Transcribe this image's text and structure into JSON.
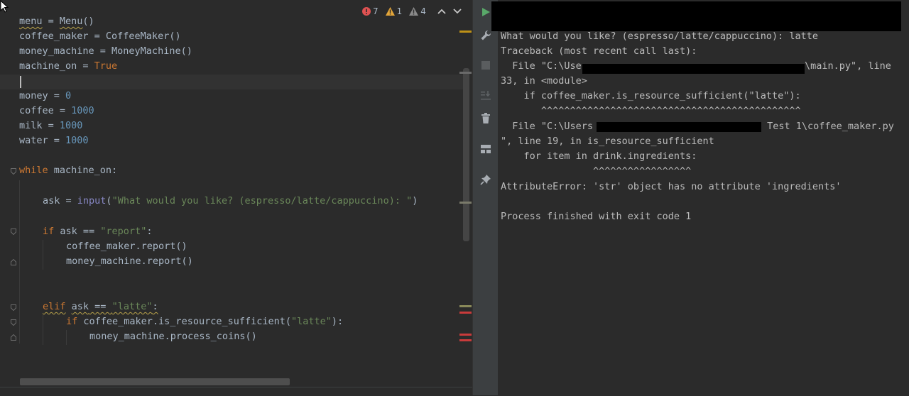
{
  "inspections": {
    "errors": "7",
    "warnings": "1",
    "weak_warnings": "4"
  },
  "code": {
    "l1": {
      "a": "menu",
      "b": " = ",
      "c": "Menu",
      "d": "()"
    },
    "l2": "coffee_maker = CoffeeMaker()",
    "l3": "money_machine = MoneyMachine()",
    "l4": {
      "a": "machine_on = ",
      "b": "True"
    },
    "l6": {
      "a": "money = ",
      "b": "0"
    },
    "l7": {
      "a": "coffee = ",
      "b": "1000"
    },
    "l8": {
      "a": "milk = ",
      "b": "1000"
    },
    "l9": {
      "a": "water = ",
      "b": "1000"
    },
    "l11": {
      "a": "while",
      "b": " machine_on:"
    },
    "l13": {
      "a": "ask = ",
      "b": "input",
      "c": "(",
      "d": "\"What would you like? (espresso/latte/cappuccino): \"",
      "e": ")"
    },
    "l15": {
      "a": "if",
      "b": " ask == ",
      "c": "\"report\"",
      "d": ":"
    },
    "l16": "coffee_maker.report()",
    "l17": "money_machine.report()",
    "l20": {
      "a": "elif",
      "b": " ",
      "c": "ask",
      "d": " == ",
      "e": "\"latte\"",
      "f": ":"
    },
    "l21": {
      "a": "if",
      "b": " coffee_maker.is_resource_sufficient(",
      "c": "\"latte\"",
      "d": "):"
    },
    "l22": "money_machine.process_coins()"
  },
  "console": {
    "prompt": "What would you like? (espresso/latte/cappuccino): latte",
    "traceback": "Traceback (most recent call last):",
    "file1_start": "  File \"C:\\Use",
    "file1_end": "\\main.py\", line",
    "file1_cont": "33, in <module>",
    "code1": "    if coffee_maker.is_resource_sufficient(\"latte\"):",
    "carets1": "       ^^^^^^^^^^^^^^^^^^^^^^^^^^^^^^^^^^^^^^^^^^^^^",
    "file2_start": "  File \"C:\\Users",
    "file2_end": " Test 1\\coffee_maker.py",
    "file2_cont": "\", line 19, in is_resource_sufficient",
    "code2": "    for item in drink.ingredients:",
    "carets2": "                ^^^^^^^^^^^^^^^^^",
    "error": "AttributeError: 'str' object has no attribute 'ingredients'",
    "exit": "Process finished with exit code 1"
  },
  "colors": {
    "background": "#2b2b2b",
    "keyword": "#cc7832",
    "number": "#6897bb",
    "string": "#6a8759",
    "builtin": "#8888c6",
    "error": "#e05252",
    "run_green": "#59a869"
  },
  "icons": [
    "run-icon",
    "wrench-icon",
    "stop-icon",
    "scroll-to-end-icon",
    "trash-icon",
    "layout-icon",
    "pin-icon"
  ]
}
